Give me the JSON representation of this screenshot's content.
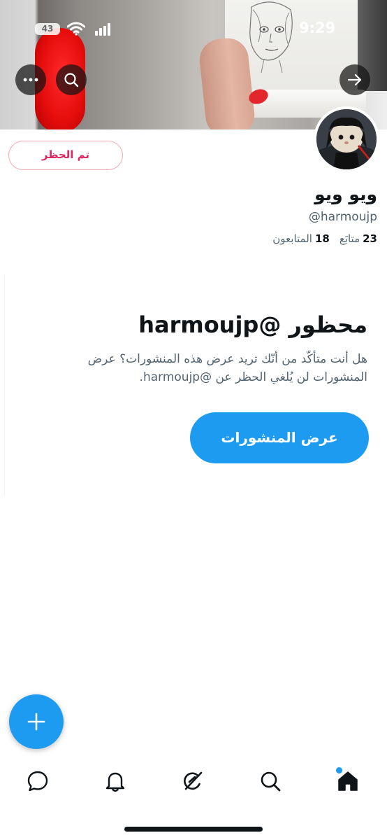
{
  "status_bar": {
    "time": "9:29",
    "battery": "43"
  },
  "profile": {
    "display_name": "ويو ويو",
    "handle": "@harmoujp",
    "following_count": "23",
    "following_label": "متابَع",
    "followers_count": "18",
    "followers_label": "المتابعون",
    "blocked_button_label": "تم الحظر"
  },
  "blocked_notice": {
    "title": "محظور @harmoujp",
    "body": "هل أنت متأكّد من أنّك تريد عرض هذه المنشورات؟ عرض المنشورات لن يُلغي الحظر عن @harmoujp.",
    "view_posts_label": "عرض المنشورات"
  },
  "icons": {
    "more": "more-icon",
    "search": "search-icon",
    "forward": "arrow-right-icon",
    "compose": "plus-icon",
    "nav": [
      "chat-icon",
      "bell-icon",
      "grok-icon",
      "search-icon",
      "home-icon"
    ]
  },
  "colors": {
    "accent": "#1d9bf0",
    "blocked_red": "#e0245e",
    "secondary_text": "#536471"
  }
}
